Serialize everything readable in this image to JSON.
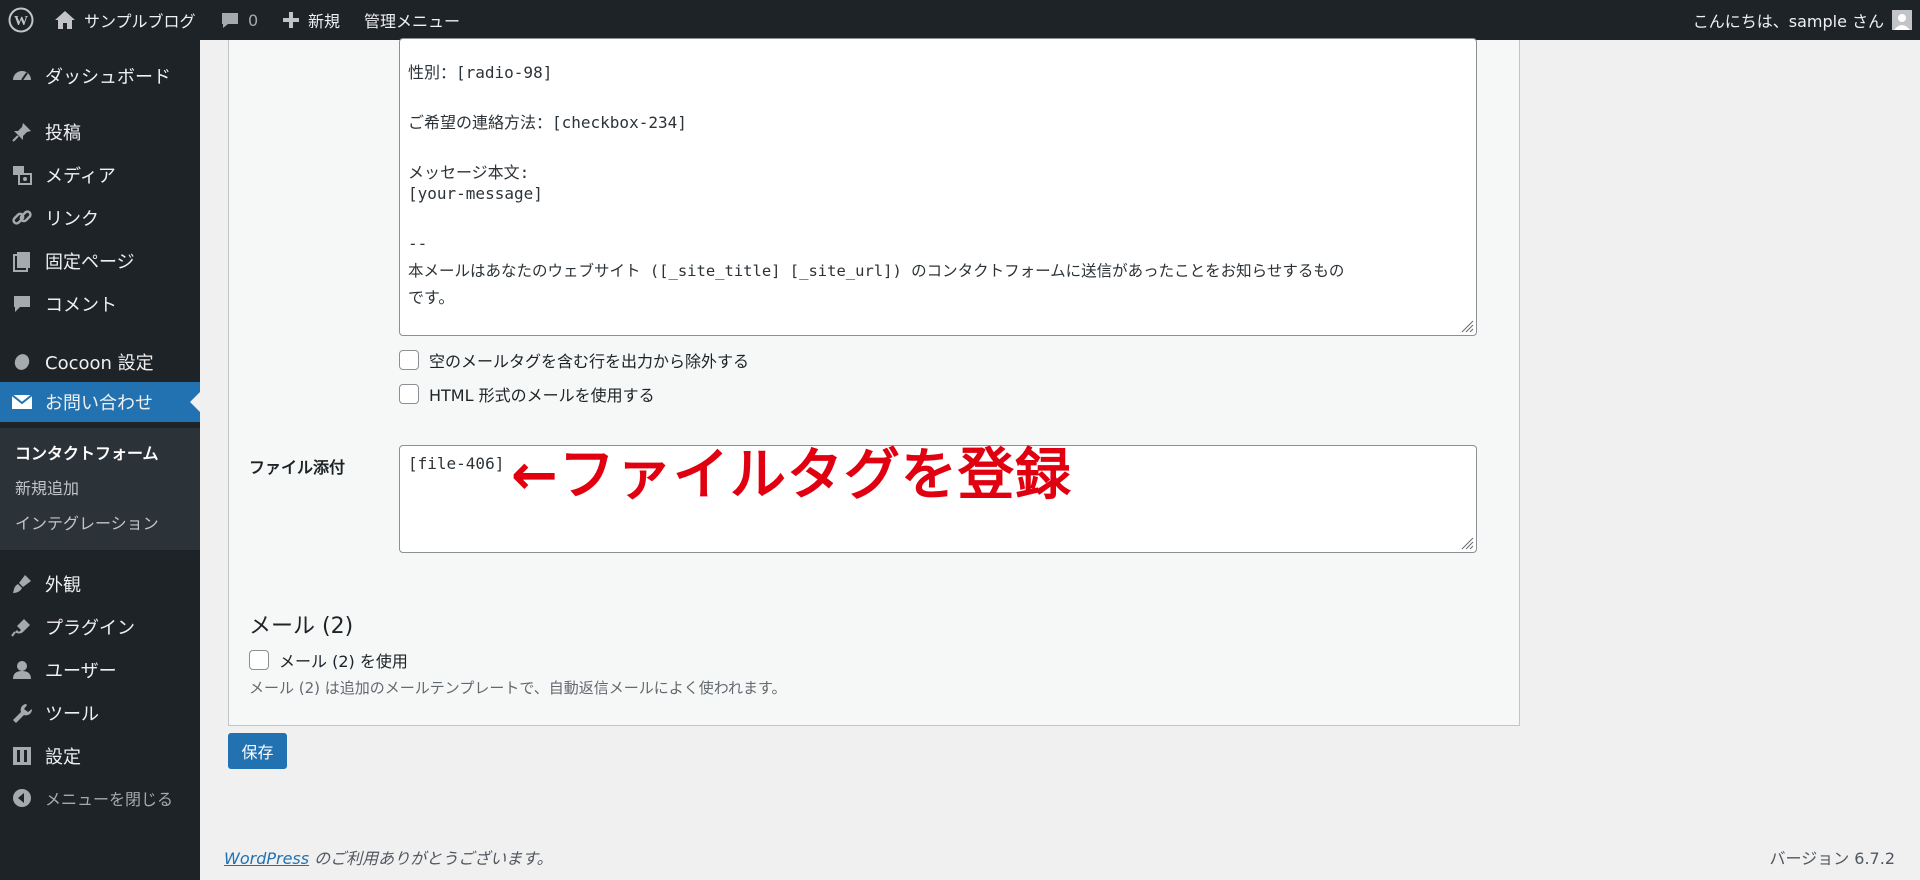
{
  "adminbar": {
    "site_name": "サンプルブログ",
    "comments_count": "0",
    "new_label": "新規",
    "admin_menu_label": "管理メニュー",
    "greeting": "こんにちは、sample さん"
  },
  "sidebar": {
    "items": [
      {
        "label": "ダッシュボード",
        "icon": "dashboard-icon"
      },
      {
        "label": "投稿",
        "icon": "pin-icon"
      },
      {
        "label": "メディア",
        "icon": "media-icon"
      },
      {
        "label": "リンク",
        "icon": "link-icon"
      },
      {
        "label": "固定ページ",
        "icon": "page-icon"
      },
      {
        "label": "コメント",
        "icon": "comment-icon"
      },
      {
        "label": "Cocoon 設定",
        "icon": "cocoon-icon"
      },
      {
        "label": "お問い合わせ",
        "icon": "mail-icon"
      },
      {
        "label": "外観",
        "icon": "brush-icon"
      },
      {
        "label": "プラグイン",
        "icon": "plugin-icon"
      },
      {
        "label": "ユーザー",
        "icon": "user-icon"
      },
      {
        "label": "ツール",
        "icon": "wrench-icon"
      },
      {
        "label": "設定",
        "icon": "settings-icon"
      },
      {
        "label": "メニューを閉じる",
        "icon": "collapse-icon"
      }
    ],
    "submenu": [
      "コンタクトフォーム",
      "新規追加",
      "インテグレーション"
    ]
  },
  "message_body": {
    "lines": [
      "性別：[radio-98]",
      "",
      "ご希望の連絡方法：[checkbox-234]",
      "",
      "メッセージ本文:",
      "[your-message]",
      "",
      "--",
      "本メールはあなたのウェブサイト ([_site_title] [_site_url]) のコンタクトフォームに送信があったことをお知らせするもの",
      "です。"
    ]
  },
  "options": {
    "exclude_blank": "空のメールタグを含む行を出力から除外する",
    "use_html": "HTML 形式のメールを使用する"
  },
  "attachments": {
    "label": "ファイル添付",
    "value": "[file-406]",
    "annotation": "←ファイルタグを登録"
  },
  "mail2": {
    "title": "メール (2)",
    "checkbox_label": "メール (2) を使用",
    "description": "メール (2) は追加のメールテンプレートで、自動返信メールによく使われます。"
  },
  "save_label": "保存",
  "footer": {
    "link_text": "WordPress",
    "thanks_text": " のご利用ありがとうございます。",
    "version": "バージョン 6.7.2"
  },
  "colors": {
    "admin_bar": "#1d2327",
    "accent": "#2271b1",
    "annotation": "#e00010"
  }
}
